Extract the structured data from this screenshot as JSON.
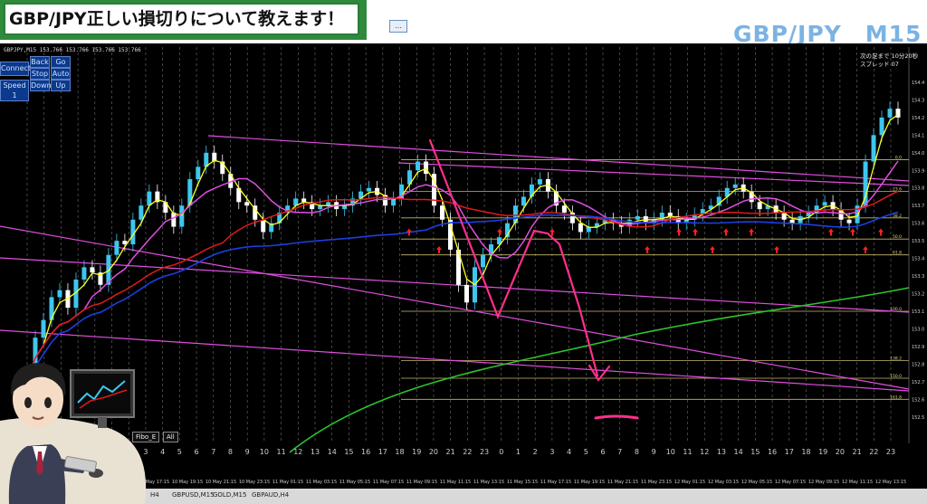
{
  "title": "GBP/JPY正しい損切りについて教えます！",
  "symbol_big": "GBP/JPY　M15",
  "ohlc_text": "GBPJPY,M15  153.766 153.766 153.766 153.766",
  "info_line1": "次の足まで 10分20秒",
  "info_line2": "スプレッド 07",
  "toolbar_icon": "...",
  "buttons": {
    "connect": "Connect",
    "speed": "Speed 1",
    "back": "Back",
    "go": "Go",
    "stop": "Stop",
    "auto": "Auto",
    "down": "Down",
    "up": "Up"
  },
  "small_buttons": {
    "fibo": "Fibo_E",
    "all": "All"
  },
  "tabs": [
    "H4",
    "GBPUSD,M15",
    "GOLD,M15",
    "GBPAUD,H4"
  ],
  "colors": {
    "bg": "#000000",
    "bull": "#3ec6ef",
    "bear": "#ffffff",
    "yellow": "#ffff22",
    "magenta": "#e04ee0",
    "red": "#e11a1a",
    "blue": "#1b3fe0",
    "green": "#2cc42c",
    "hline": "#c9b86a",
    "pink": "#ff2f8d",
    "arrow": "#ff2020",
    "title_green": "#2f8a3d"
  },
  "chart_data": {
    "type": "candlestick",
    "ylim": [
      152.35,
      154.6
    ],
    "x_tick_labels": [
      "20",
      "21",
      "22",
      "23",
      "0",
      "1",
      "2",
      "3",
      "4",
      "5",
      "6",
      "7",
      "8",
      "9",
      "10",
      "11",
      "12",
      "13",
      "14",
      "15",
      "16",
      "17",
      "18",
      "19",
      "20",
      "21",
      "22",
      "23",
      "0",
      "1",
      "2",
      "3",
      "4",
      "5",
      "6",
      "7",
      "8",
      "9",
      "10",
      "11",
      "12",
      "13",
      "14",
      "15",
      "16",
      "17",
      "18",
      "19",
      "20",
      "21",
      "22",
      "23"
    ],
    "date_labels": [
      "10 May 17:15",
      "10 May 19:15",
      "10 May 21:15",
      "10 May 23:15",
      "11 May 01:15",
      "11 May 03:15",
      "11 May 05:15",
      "11 May 07:15",
      "11 May 09:15",
      "11 May 11:15",
      "11 May 13:15",
      "11 May 15:15",
      "11 May 17:15",
      "11 May 19:15",
      "11 May 21:15",
      "11 May 23:15",
      "12 May 01:15",
      "12 May 03:15",
      "12 May 05:15",
      "12 May 07:15",
      "12 May 09:15",
      "12 May 11:15",
      "12 May 13:15"
    ],
    "price_labels": [
      {
        "price": 154.4,
        "text": "154.4"
      },
      {
        "price": 154.3,
        "text": "154.3"
      },
      {
        "price": 154.2,
        "text": "154.2"
      },
      {
        "price": 154.1,
        "text": "154.1"
      },
      {
        "price": 154.0,
        "text": "154.0"
      },
      {
        "price": 153.9,
        "text": "153.9"
      },
      {
        "price": 153.8,
        "text": "153.8"
      },
      {
        "price": 153.7,
        "text": "153.7"
      },
      {
        "price": 153.6,
        "text": "153.6"
      },
      {
        "price": 153.5,
        "text": "153.5"
      },
      {
        "price": 153.4,
        "text": "153.4"
      },
      {
        "price": 153.3,
        "text": "153.3"
      },
      {
        "price": 153.2,
        "text": "153.2"
      },
      {
        "price": 153.1,
        "text": "153.1"
      },
      {
        "price": 153.0,
        "text": "153.0"
      },
      {
        "price": 152.9,
        "text": "152.9"
      },
      {
        "price": 152.8,
        "text": "152.8"
      },
      {
        "price": 152.7,
        "text": "152.7"
      },
      {
        "price": 152.6,
        "text": "152.6"
      },
      {
        "price": 152.5,
        "text": "152.5"
      }
    ],
    "fib_levels": [
      {
        "price": 153.96,
        "label": "0.0"
      },
      {
        "price": 153.78,
        "label": "23.6"
      },
      {
        "price": 153.63,
        "label": "38.2"
      },
      {
        "price": 153.51,
        "label": "50.0"
      },
      {
        "price": 153.42,
        "label": "61.8"
      },
      {
        "price": 153.1,
        "label": "100.0"
      },
      {
        "price": 152.82,
        "label": "138.2"
      },
      {
        "price": 152.72,
        "label": "150.0"
      },
      {
        "price": 152.6,
        "label": "161.8"
      }
    ],
    "current_price": 153.766,
    "candles_closes": [
      152.72,
      152.95,
      153.05,
      153.18,
      153.22,
      153.12,
      153.28,
      153.35,
      153.32,
      153.25,
      153.42,
      153.5,
      153.48,
      153.62,
      153.7,
      153.78,
      153.72,
      153.66,
      153.58,
      153.7,
      153.85,
      153.92,
      154.0,
      153.95,
      153.88,
      153.8,
      153.72,
      153.7,
      153.62,
      153.55,
      153.6,
      153.66,
      153.7,
      153.74,
      153.72,
      153.68,
      153.7,
      153.72,
      153.68,
      153.7,
      153.74,
      153.78,
      153.8,
      153.76,
      153.7,
      153.74,
      153.82,
      153.9,
      153.95,
      153.88,
      153.7,
      153.62,
      153.45,
      153.25,
      153.15,
      153.35,
      153.42,
      153.48,
      153.52,
      153.6,
      153.7,
      153.75,
      153.82,
      153.85,
      153.78,
      153.7,
      153.66,
      153.6,
      153.55,
      153.58,
      153.6,
      153.62,
      153.6,
      153.58,
      153.62,
      153.64,
      153.6,
      153.62,
      153.66,
      153.64,
      153.6,
      153.62,
      153.65,
      153.68,
      153.7,
      153.75,
      153.8,
      153.82,
      153.78,
      153.72,
      153.68,
      153.7,
      153.66,
      153.62,
      153.6,
      153.64,
      153.66,
      153.7,
      153.72,
      153.68,
      153.62,
      153.6,
      153.7,
      153.95,
      154.1,
      154.2,
      154.25,
      154.2
    ]
  }
}
